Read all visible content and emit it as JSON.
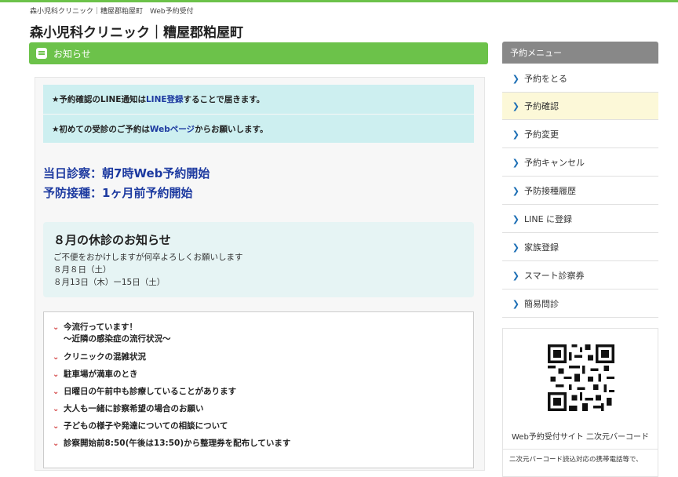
{
  "header": {
    "breadcrumb": "森小児科クリニック｜糟屋郡粕屋町　Web予約受付",
    "title": "森小児科クリニック｜糟屋郡粕屋町"
  },
  "notice_bar": {
    "label": "お知らせ",
    "icon": "speech-bubble-icon"
  },
  "info_boxes": [
    {
      "pre": "★予約確認のLINE通知は",
      "link": "LINE登録",
      "post": "することで届きます。"
    },
    {
      "pre": "★初めての受診のご予約は",
      "link": "Webページ",
      "post": "からお願いします。"
    }
  ],
  "headlines": [
    "当日診察：朝7時Web予約開始",
    "予防接種：1ヶ月前予約開始"
  ],
  "closed_notice": {
    "title": "８月の休診のお知らせ",
    "lines": [
      "ご不便をおかけしますが何卒よろしくお願いします",
      "８月８日（土）",
      "８月13日（木）ー15日（土）"
    ]
  },
  "info_links": [
    {
      "line1": "今流行っています！",
      "line2": "〜近隣の感染症の流行状況〜"
    },
    {
      "line1": "クリニックの混雑状況"
    },
    {
      "line1": "駐車場が満車のとき"
    },
    {
      "line1": "日曜日の午前中も診療していることがあります"
    },
    {
      "line1": "大人も一緒に診察希望の場合のお願い"
    },
    {
      "line1": "子どもの様子や発達についての相談について"
    },
    {
      "line1": "診察開始前8:50(午後は13:50)から整理券を配布しています"
    }
  ],
  "sidebar": {
    "title": "予約メニュー",
    "items": [
      {
        "label": "予約をとる"
      },
      {
        "label": "予約確認"
      },
      {
        "label": "予約変更"
      },
      {
        "label": "予約キャンセル"
      },
      {
        "label": "予防接種履歴"
      },
      {
        "label": "LINE に登録"
      },
      {
        "label": "家族登録"
      },
      {
        "label": "スマート診察券"
      },
      {
        "label": "簡易問診"
      }
    ],
    "active_index": 1
  },
  "qr": {
    "caption": "Web予約受付サイト 二次元バーコード",
    "note": "二次元バーコード読込対応の携帯電話等で、"
  },
  "colors": {
    "accent_green": "#6cc24a",
    "link_blue": "#1d3aa0",
    "info_bg": "#cdeff0",
    "active_bg": "#fcf8d8"
  }
}
